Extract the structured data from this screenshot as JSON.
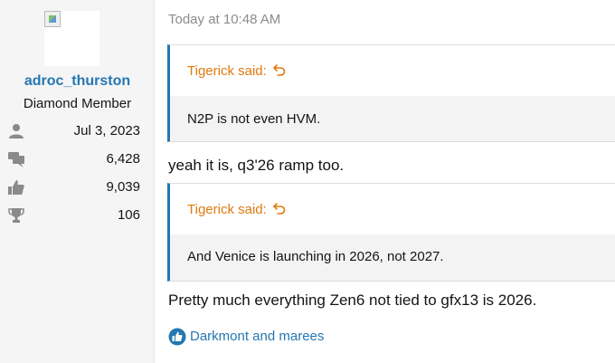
{
  "user": {
    "username": "adroc_thurston",
    "title": "Diamond Member",
    "stats": [
      {
        "icon": "user-icon",
        "value": "Jul 3, 2023"
      },
      {
        "icon": "messages-icon",
        "value": "6,428"
      },
      {
        "icon": "thumbs-up-icon",
        "value": "9,039"
      },
      {
        "icon": "trophy-icon",
        "value": "106"
      }
    ]
  },
  "post": {
    "timestamp": "Today at 10:48 AM",
    "quotes": [
      {
        "author": "Tigerick said:",
        "text": "N2P is not even HVM."
      },
      {
        "author": "Tigerick said:",
        "text": "And Venice is launching in 2026, not 2027."
      }
    ],
    "replies": [
      "yeah it is, q3'26 ramp too.",
      "Pretty much everything Zen6 not tied to gfx13 is 2026."
    ],
    "reactions": "Darkmont and marees"
  },
  "colors": {
    "link": "#2577b1",
    "quote_author": "#e07a0f",
    "muted": "#8c8c8c",
    "stat_icon": "#8a8a8a"
  }
}
